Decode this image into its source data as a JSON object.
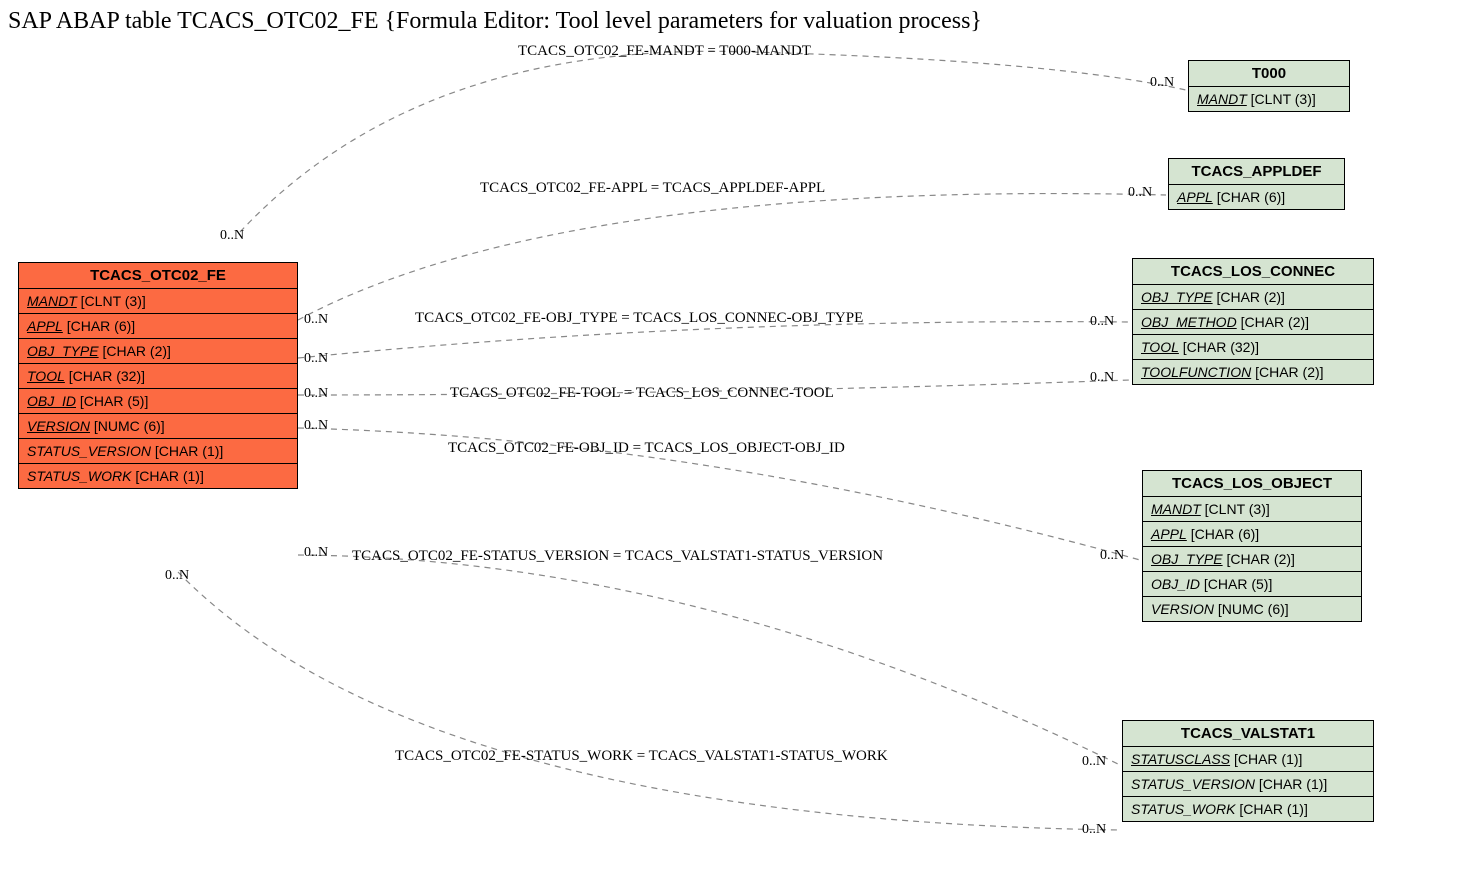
{
  "title": "SAP ABAP table TCACS_OTC02_FE {Formula Editor: Tool level parameters for valuation process}",
  "main": {
    "name": "TCACS_OTC02_FE",
    "fields": [
      {
        "name": "MANDT",
        "type": "[CLNT (3)]",
        "u": true
      },
      {
        "name": "APPL",
        "type": "[CHAR (6)]",
        "u": true
      },
      {
        "name": "OBJ_TYPE",
        "type": "[CHAR (2)]",
        "u": true
      },
      {
        "name": "TOOL",
        "type": "[CHAR (32)]",
        "u": true
      },
      {
        "name": "OBJ_ID",
        "type": "[CHAR (5)]",
        "u": true
      },
      {
        "name": "VERSION",
        "type": "[NUMC (6)]",
        "u": true
      },
      {
        "name": "STATUS_VERSION",
        "type": "[CHAR (1)]",
        "u": false
      },
      {
        "name": "STATUS_WORK",
        "type": "[CHAR (1)]",
        "u": false
      }
    ]
  },
  "targets": {
    "t000": {
      "name": "T000",
      "fields": [
        {
          "name": "MANDT",
          "type": "[CLNT (3)]",
          "u": true
        }
      ]
    },
    "appldef": {
      "name": "TCACS_APPLDEF",
      "fields": [
        {
          "name": "APPL",
          "type": "[CHAR (6)]",
          "u": true
        }
      ]
    },
    "losconnec": {
      "name": "TCACS_LOS_CONNEC",
      "fields": [
        {
          "name": "OBJ_TYPE",
          "type": "[CHAR (2)]",
          "u": true
        },
        {
          "name": "OBJ_METHOD",
          "type": "[CHAR (2)]",
          "u": true
        },
        {
          "name": "TOOL",
          "type": "[CHAR (32)]",
          "u": true
        },
        {
          "name": "TOOLFUNCTION",
          "type": "[CHAR (2)]",
          "u": true
        }
      ]
    },
    "losobject": {
      "name": "TCACS_LOS_OBJECT",
      "fields": [
        {
          "name": "MANDT",
          "type": "[CLNT (3)]",
          "u": true
        },
        {
          "name": "APPL",
          "type": "[CHAR (6)]",
          "u": true
        },
        {
          "name": "OBJ_TYPE",
          "type": "[CHAR (2)]",
          "u": true
        },
        {
          "name": "OBJ_ID",
          "type": "[CHAR (5)]",
          "u": false
        },
        {
          "name": "VERSION",
          "type": "[NUMC (6)]",
          "u": false
        }
      ]
    },
    "valstat1": {
      "name": "TCACS_VALSTAT1",
      "fields": [
        {
          "name": "STATUSCLASS",
          "type": "[CHAR (1)]",
          "u": true
        },
        {
          "name": "STATUS_VERSION",
          "type": "[CHAR (1)]",
          "u": false
        },
        {
          "name": "STATUS_WORK",
          "type": "[CHAR (1)]",
          "u": false
        }
      ]
    }
  },
  "rels": {
    "r1": "TCACS_OTC02_FE-MANDT = T000-MANDT",
    "r2": "TCACS_OTC02_FE-APPL = TCACS_APPLDEF-APPL",
    "r3": "TCACS_OTC02_FE-OBJ_TYPE = TCACS_LOS_CONNEC-OBJ_TYPE",
    "r4": "TCACS_OTC02_FE-TOOL = TCACS_LOS_CONNEC-TOOL",
    "r5": "TCACS_OTC02_FE-OBJ_ID = TCACS_LOS_OBJECT-OBJ_ID",
    "r6": "TCACS_OTC02_FE-STATUS_VERSION = TCACS_VALSTAT1-STATUS_VERSION",
    "r7": "TCACS_OTC02_FE-STATUS_WORK = TCACS_VALSTAT1-STATUS_WORK"
  },
  "card": "0..N"
}
